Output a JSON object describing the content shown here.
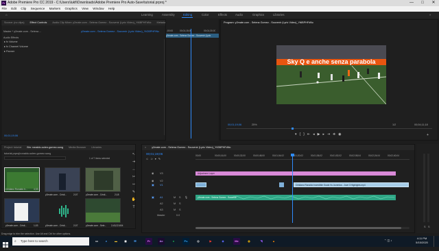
{
  "window": {
    "title": "Adobe Premiere Pro CC 2019 - C:\\Users\\lukfi\\Downloads\\Adobe Premiere Pro Auto-Save\\tutorial.prproj *",
    "app_badge": "Pr",
    "minimize": "—",
    "maximize": "□",
    "close": "✕"
  },
  "menu": [
    "File",
    "Edit",
    "Clip",
    "Sequence",
    "Markers",
    "Graphics",
    "View",
    "Window",
    "Help"
  ],
  "workspaces": {
    "items": [
      "Learning",
      "Assembly",
      "Editing",
      "Color",
      "Effects",
      "Audio",
      "Graphics",
      "Libraries"
    ],
    "active": "Editing"
  },
  "source_panel": {
    "tabs": [
      "Source: (no clips)",
      "Effect Controls",
      "Audio Clip Mixer: y2mate.com - Selena Gomez - Souvenir (Lyric Video)_Yt6BPHFdNc",
      "Metadata"
    ],
    "active_tab": "Effect Controls",
    "master_row": "Master * y2mate.com - Selena ...",
    "clip_row": "y2mate.com - Selena Gomez - Souvenir (Lyric Video)_YtGBPHFtNc",
    "ruler_start": ";00:00",
    "ruler_mid": "00;01;15;00",
    "ruler_end": "00;01;30;00",
    "mini_clip": "y2mate.com - Selena Gomez - Souvenir (Lyric",
    "section": "Audio Effects",
    "effects": [
      "Volume",
      "Channel Volume",
      "Panner"
    ],
    "timecode": "00;01;19;06"
  },
  "program": {
    "title": "Program: y2mate.com - Selena Gomez - Souvenir (Lyric Video)_Yt6BPHFdNc",
    "timecode": "00;01;19;06",
    "zoom": "25%",
    "quality": "1/2",
    "duration": "00;04;11;18",
    "banner_text": "Sky Q e anche senza parabola"
  },
  "project": {
    "tabs": [
      "Project: tutorial",
      "Bin: ronaldo-solen-gomez-song",
      "Media Browser",
      "Libraries"
    ],
    "active_tab": "Bin: ronaldo-solen-gomez-song",
    "path": "tutorial.prproj\\ronaldo-solen-gomez-song",
    "selection": "1 of 7 items selected",
    "items": [
      {
        "name": "Cristiano Ronaldo Ir...",
        "duration": "4;33"
      },
      {
        "name": "y2mate.com - Cristi...",
        "duration": "2;07"
      },
      {
        "name": "y2mate.com - Cristi...",
        "duration": "2;18"
      },
      {
        "name": "y2mate.com - Cristi...",
        "duration": "1;03"
      },
      {
        "name": "y2mate.com - Cristi...",
        "duration": "2;07"
      },
      {
        "name": "y2mate.com - Sele...",
        "duration": "2;43;22;604"
      }
    ]
  },
  "timeline": {
    "tab": "y2mate.com - Selena Gomez - Souvenir (Lyric Video)_YtGBPHFdNc",
    "timecode": "00;01;19;06",
    "ruler": [
      "00;00",
      "00;00;16;00",
      "00;00;32;00",
      "00;00;48;00",
      "00;01;04;02",
      "00;01;20;02",
      "00;01;36;02",
      "00;01;52;02",
      "00;02;08;04",
      "00;02;24;04",
      "00;02;40;04"
    ],
    "tracks": [
      "V3",
      "V2",
      "V1",
      "A1",
      "A2",
      "A3"
    ],
    "master_label": "Master",
    "master_value": "0.0",
    "clip_v2": "Adjustment Layer",
    "clip_v1": "Cristiano Ronaldo Incredible Goals Vs Juventus - Juve 3 Highlights.mp4",
    "clip_a1": "y2mate.com - Selena Gomez - Souvenir"
  },
  "taskbar": {
    "search_placeholder": "Type here to search",
    "time": "4:11 PM",
    "date": "5/15/2020"
  },
  "status_bar": "Drag edge to trim the selection. Use Alt and Ctrl for other options."
}
